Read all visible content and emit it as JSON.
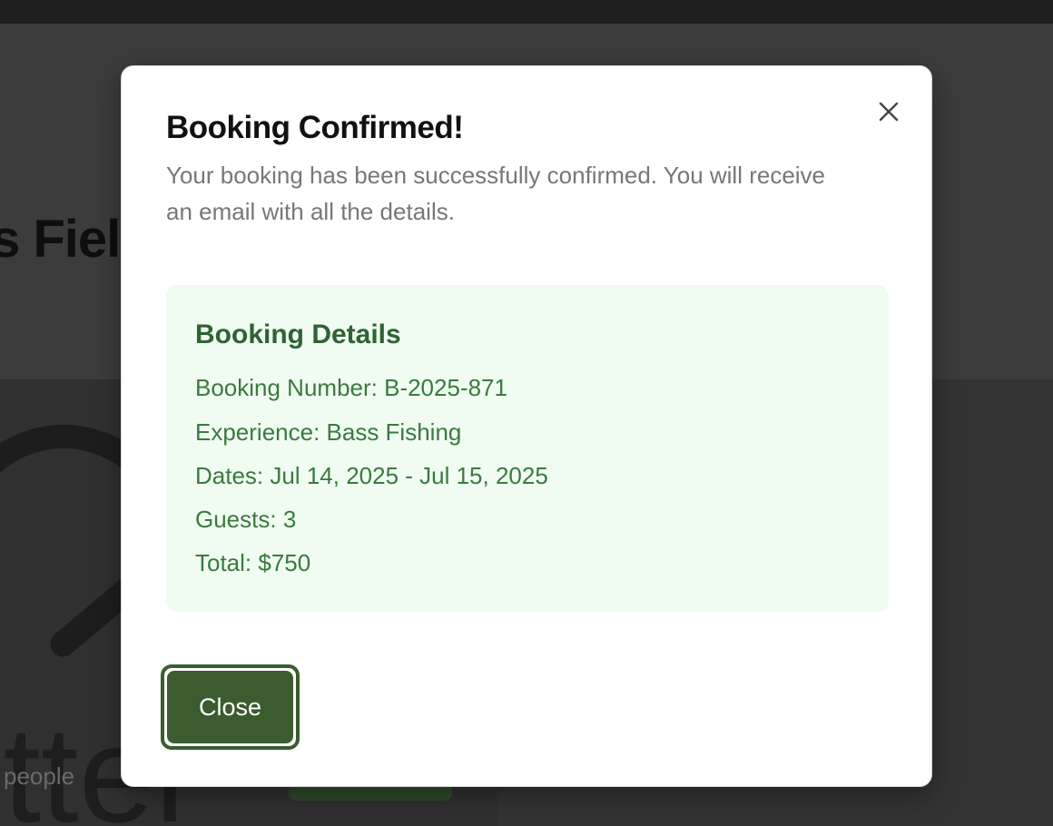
{
  "background": {
    "title_fragment": "s Fiel",
    "image_text_fragment": "itter",
    "caption_fragment": "people"
  },
  "modal": {
    "title": "Booking Confirmed!",
    "description": "Your booking has been successfully confirmed. You will receive an email with all the details.",
    "close_icon": "close-icon",
    "details": {
      "title": "Booking Details",
      "booking_number": "Booking Number: B-2025-871",
      "experience": "Experience: Bass Fishing",
      "dates": "Dates: Jul 14, 2025 - Jul 15, 2025",
      "guests": "Guests: 3",
      "total": "Total: $750"
    },
    "close_button_label": "Close"
  },
  "colors": {
    "accent": "#3a5c2f",
    "details_bg": "#f0fbf2",
    "details_text": "#3b7a3f"
  }
}
